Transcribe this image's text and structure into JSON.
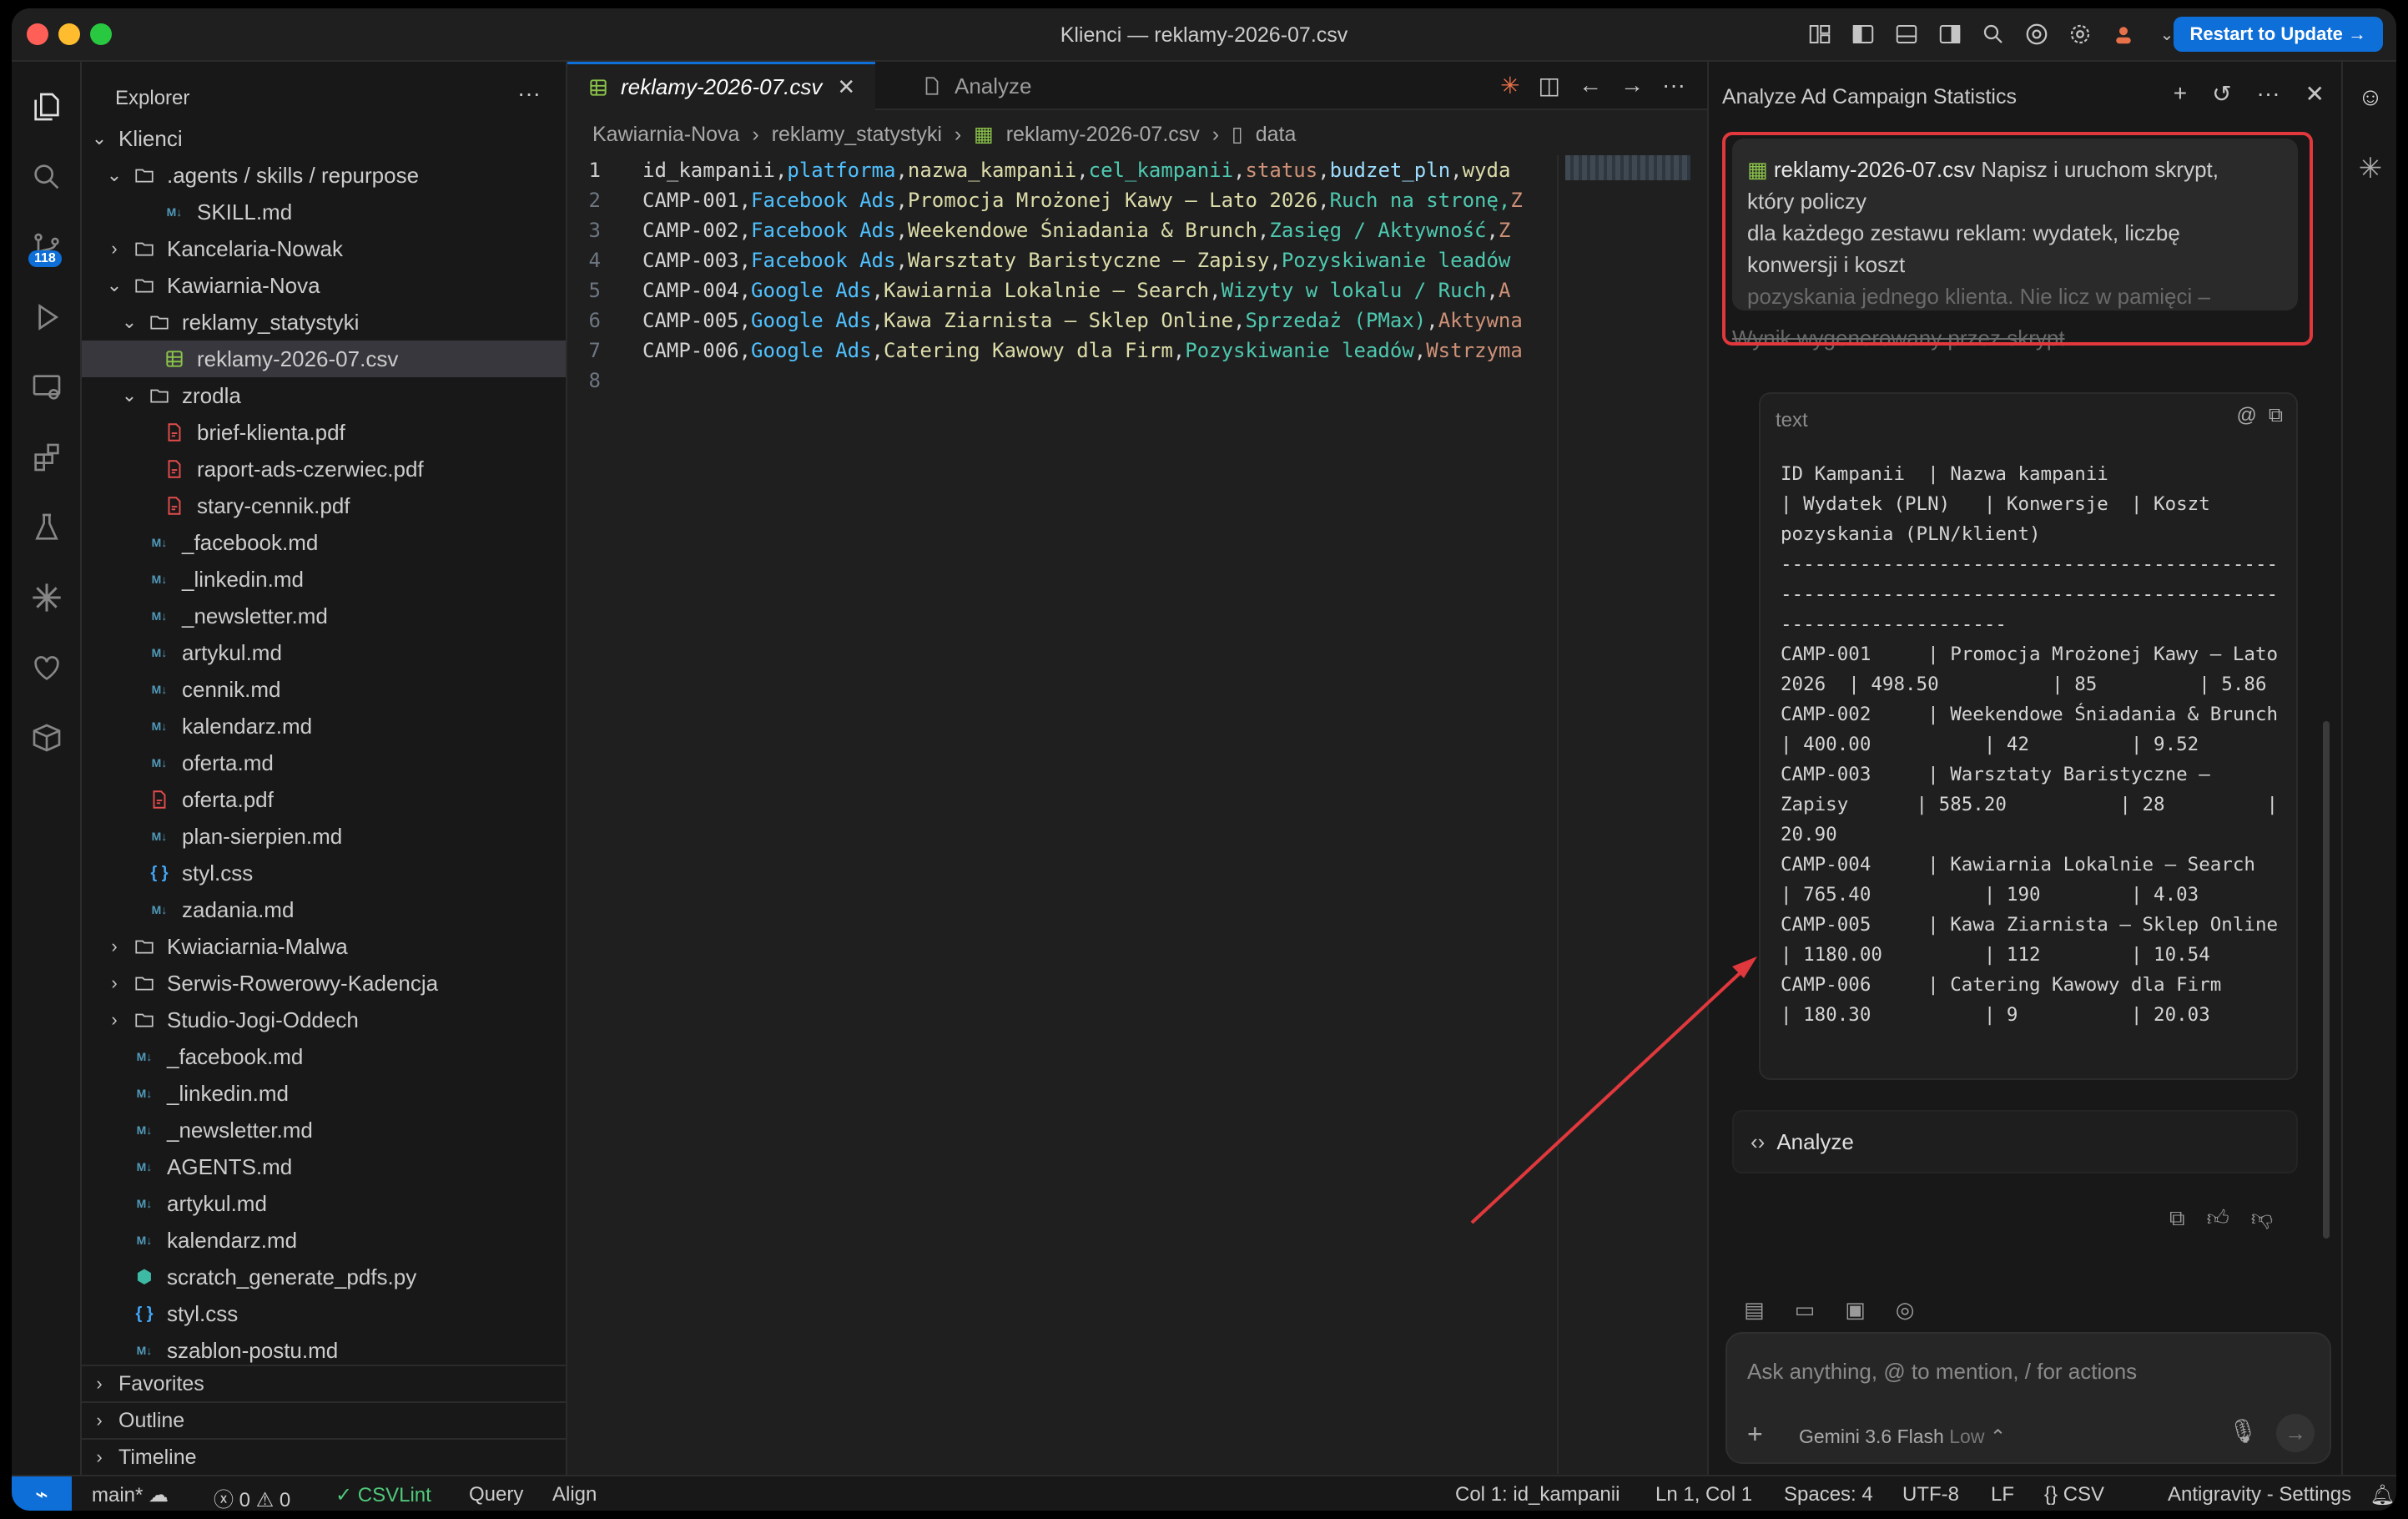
{
  "window": {
    "title": "Klienci — reklamy-2026-07.csv",
    "update_button": "Restart to Update →"
  },
  "activity_bar": {
    "source_control_badge": "118"
  },
  "explorer": {
    "header": "Explorer",
    "more": "···",
    "root": "Klienci",
    "tree": [
      {
        "label": ".agents / skills / repurpose",
        "type": "folder",
        "open": true,
        "depth": 1
      },
      {
        "label": "SKILL.md",
        "type": "md",
        "depth": 3
      },
      {
        "label": "Kancelaria-Nowak",
        "type": "folder",
        "open": false,
        "depth": 1
      },
      {
        "label": "Kawiarnia-Nova",
        "type": "folder",
        "open": true,
        "depth": 1
      },
      {
        "label": "reklamy_statystyki",
        "type": "folder",
        "open": true,
        "depth": 2
      },
      {
        "label": "reklamy-2026-07.csv",
        "type": "csv",
        "depth": 3,
        "selected": true
      },
      {
        "label": "zrodla",
        "type": "folder",
        "open": true,
        "depth": 2
      },
      {
        "label": "brief-klienta.pdf",
        "type": "pdf",
        "depth": 3
      },
      {
        "label": "raport-ads-czerwiec.pdf",
        "type": "pdf",
        "depth": 3
      },
      {
        "label": "stary-cennik.pdf",
        "type": "pdf",
        "depth": 3
      },
      {
        "label": "_facebook.md",
        "type": "md",
        "depth": 2
      },
      {
        "label": "_linkedin.md",
        "type": "md",
        "depth": 2
      },
      {
        "label": "_newsletter.md",
        "type": "md",
        "depth": 2
      },
      {
        "label": "artykul.md",
        "type": "md",
        "depth": 2
      },
      {
        "label": "cennik.md",
        "type": "md",
        "depth": 2
      },
      {
        "label": "kalendarz.md",
        "type": "md",
        "depth": 2
      },
      {
        "label": "oferta.md",
        "type": "md",
        "depth": 2
      },
      {
        "label": "oferta.pdf",
        "type": "pdf",
        "depth": 2
      },
      {
        "label": "plan-sierpien.md",
        "type": "md",
        "depth": 2
      },
      {
        "label": "styl.css",
        "type": "css",
        "depth": 2
      },
      {
        "label": "zadania.md",
        "type": "md",
        "depth": 2
      },
      {
        "label": "Kwiaciarnia-Malwa",
        "type": "folder",
        "open": false,
        "depth": 1
      },
      {
        "label": "Serwis-Rowerowy-Kadencja",
        "type": "folder",
        "open": false,
        "depth": 1
      },
      {
        "label": "Studio-Jogi-Oddech",
        "type": "folder",
        "open": false,
        "depth": 1
      },
      {
        "label": "_facebook.md",
        "type": "md",
        "depth": 1
      },
      {
        "label": "_linkedin.md",
        "type": "md",
        "depth": 1
      },
      {
        "label": "_newsletter.md",
        "type": "md",
        "depth": 1
      },
      {
        "label": "AGENTS.md",
        "type": "md",
        "depth": 1
      },
      {
        "label": "artykul.md",
        "type": "md",
        "depth": 1
      },
      {
        "label": "kalendarz.md",
        "type": "md",
        "depth": 1
      },
      {
        "label": "scratch_generate_pdfs.py",
        "type": "py",
        "depth": 1
      },
      {
        "label": "styl.css",
        "type": "css",
        "depth": 1
      },
      {
        "label": "szablon-postu.md",
        "type": "md",
        "depth": 1
      }
    ],
    "sections": [
      "Favorites",
      "Outline",
      "Timeline"
    ]
  },
  "editor": {
    "tabs": [
      {
        "label": "reklamy-2026-07.csv",
        "active": true
      },
      {
        "label": "Analyze",
        "active": false
      }
    ],
    "breadcrumb": [
      "Kawiarnia-Nova",
      "reklamy_statystyki",
      "reklamy-2026-07.csv",
      "data"
    ],
    "lines": [
      [
        [
          "id_kampanii",
          "#d4d4d4"
        ],
        [
          ",",
          "#d4d4d4"
        ],
        [
          "platforma",
          "#4fc1ff"
        ],
        [
          ",",
          "#d4d4d4"
        ],
        [
          "nazwa_kampanii",
          "#dcdcaa"
        ],
        [
          ",",
          "#d4d4d4"
        ],
        [
          "cel_kampanii",
          "#4ec9b0"
        ],
        [
          ",",
          "#d4d4d4"
        ],
        [
          "status",
          "#ce9178"
        ],
        [
          ",",
          "#d4d4d4"
        ],
        [
          "budzet_pln",
          "#9cdcfe"
        ],
        [
          ",",
          "#d4d4d4"
        ],
        [
          "wyda",
          "#dcdcaa"
        ]
      ],
      [
        [
          "CAMP-001",
          "#d4d4d4"
        ],
        [
          ",",
          "#d4d4d4"
        ],
        [
          "Facebook Ads",
          "#4fc1ff"
        ],
        [
          ",",
          "#d4d4d4"
        ],
        [
          "Promocja Mrożonej Kawy – Lato 2026",
          "#dcdcaa"
        ],
        [
          ",",
          "#d4d4d4"
        ],
        [
          "Ruch na stronę,",
          "#4ec9b0"
        ],
        [
          "Z",
          "#ce9178"
        ]
      ],
      [
        [
          "CAMP-002",
          "#d4d4d4"
        ],
        [
          ",",
          "#d4d4d4"
        ],
        [
          "Facebook Ads",
          "#4fc1ff"
        ],
        [
          ",",
          "#d4d4d4"
        ],
        [
          "Weekendowe Śniadania & Brunch",
          "#dcdcaa"
        ],
        [
          ",",
          "#d4d4d4"
        ],
        [
          "Zasięg / Aktywność",
          "#4ec9b0"
        ],
        [
          ",",
          "#d4d4d4"
        ],
        [
          "Z",
          "#ce9178"
        ]
      ],
      [
        [
          "CAMP-003",
          "#d4d4d4"
        ],
        [
          ",",
          "#d4d4d4"
        ],
        [
          "Facebook Ads",
          "#4fc1ff"
        ],
        [
          ",",
          "#d4d4d4"
        ],
        [
          "Warsztaty Baristyczne – Zapisy",
          "#dcdcaa"
        ],
        [
          ",",
          "#d4d4d4"
        ],
        [
          "Pozyskiwanie leadów",
          "#4ec9b0"
        ]
      ],
      [
        [
          "CAMP-004",
          "#d4d4d4"
        ],
        [
          ",",
          "#d4d4d4"
        ],
        [
          "Google Ads",
          "#4fc1ff"
        ],
        [
          ",",
          "#d4d4d4"
        ],
        [
          "Kawiarnia Lokalnie – Search",
          "#dcdcaa"
        ],
        [
          ",",
          "#d4d4d4"
        ],
        [
          "Wizyty w lokalu / Ruch",
          "#4ec9b0"
        ],
        [
          ",",
          "#d4d4d4"
        ],
        [
          "A",
          "#ce9178"
        ]
      ],
      [
        [
          "CAMP-005",
          "#d4d4d4"
        ],
        [
          ",",
          "#d4d4d4"
        ],
        [
          "Google Ads",
          "#4fc1ff"
        ],
        [
          ",",
          "#d4d4d4"
        ],
        [
          "Kawa Ziarnista – Sklep Online",
          "#dcdcaa"
        ],
        [
          ",",
          "#d4d4d4"
        ],
        [
          "Sprzedaż (PMax)",
          "#4ec9b0"
        ],
        [
          ",",
          "#d4d4d4"
        ],
        [
          "Aktywna",
          "#ce9178"
        ]
      ],
      [
        [
          "CAMP-006",
          "#d4d4d4"
        ],
        [
          ",",
          "#d4d4d4"
        ],
        [
          "Google Ads",
          "#4fc1ff"
        ],
        [
          ",",
          "#d4d4d4"
        ],
        [
          "Catering Kawowy dla Firm",
          "#dcdcaa"
        ],
        [
          ",",
          "#d4d4d4"
        ],
        [
          "Pozyskiwanie leadów",
          "#4ec9b0"
        ],
        [
          ",",
          "#d4d4d4"
        ],
        [
          "Wstrzyma",
          "#ce9178"
        ]
      ],
      []
    ]
  },
  "chat": {
    "title": "Analyze Ad Campaign Statistics",
    "prompt_file": "reklamy-2026-07.csv",
    "prompt_text_1": "Napisz i uruchom skrypt,",
    "prompt_text_2": "który policzy",
    "prompt_text_3": "dla każdego zestawu reklam: wydatek, liczbę",
    "prompt_text_4": "konwersji i koszt",
    "prompt_text_5": "pozyskania jednego klienta. Nie licz w pamięci –",
    "faded_text": "Wynik wygenerowany przez skrypt",
    "code_label": "text",
    "code_output": "ID Kampanii  | Nazwa kampanii\n| Wydatek (PLN)   | Konwersje  | Koszt\npozyskania (PLN/klient)\n--------------------------------------------\n--------------------------------------------\n--------------------\nCAMP-001     | Promocja Mrożonej Kawy – Lato\n2026  | 498.50          | 85         | 5.86\nCAMP-002     | Weekendowe Śniadania & Brunch\n| 400.00          | 42         | 9.52\nCAMP-003     | Warsztaty Baristyczne –\nZapisy      | 585.20          | 28         |\n20.90\nCAMP-004     | Kawiarnia Lokalnie – Search\n| 765.40          | 190        | 4.03\nCAMP-005     | Kawa Ziarnista – Sklep Online\n| 1180.00         | 112        | 10.54\nCAMP-006     | Catering Kawowy dla Firm\n| 180.30          | 9          | 20.03",
    "analyze_card": "Analyze",
    "input_placeholder": "Ask anything, @ to mention, / for actions",
    "model": "Gemini 3.6 Flash",
    "model_mode": "Low"
  },
  "status_bar": {
    "branch": "main*",
    "errors": "0",
    "warnings": "0",
    "csvlint": "CSVLint",
    "query": "Query",
    "align": "Align",
    "column": "Col 1: id_kampanii",
    "position": "Ln 1, Col 1",
    "spaces": "Spaces: 4",
    "encoding": "UTF-8",
    "eol": "LF",
    "language": "CSV",
    "settings": "Antigravity - Settings"
  },
  "colors": {
    "accent": "#0e6fd8",
    "annotation": "#e0383c"
  }
}
